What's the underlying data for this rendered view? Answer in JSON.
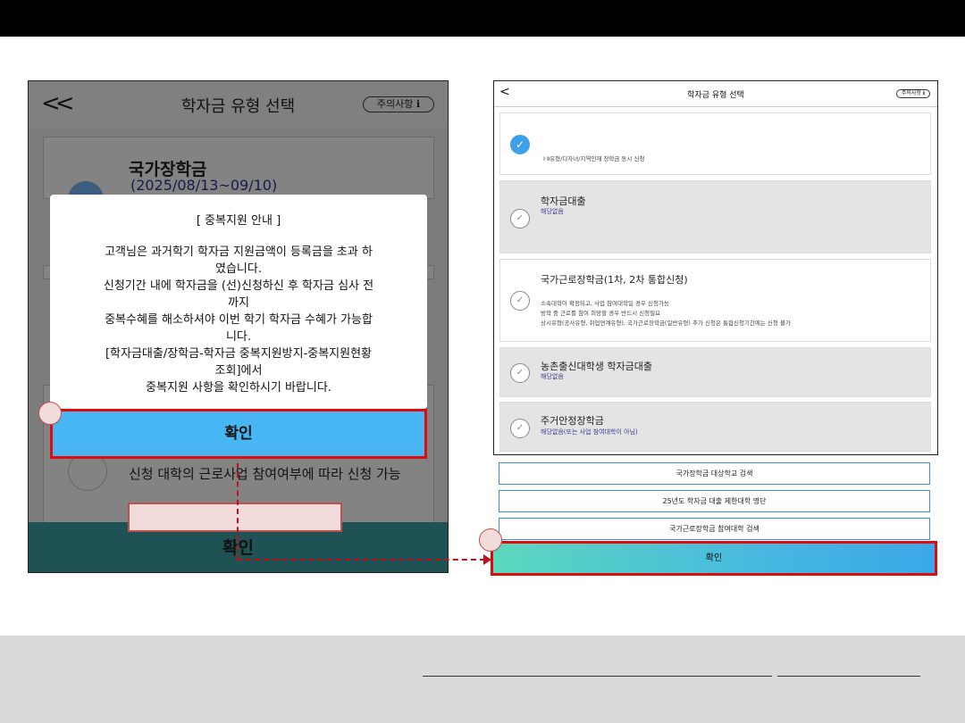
{
  "left": {
    "back_glyph": "<<",
    "title": "학자금 유형 선택",
    "notice_label": "주의사항 ℹ",
    "card_title": "국가장학금",
    "card_date": "(2025/08/13~09/10)",
    "bg_text": "신청 대학의 근로사업 참여여부에 따라 신청 가능",
    "footer_confirm": "확인",
    "dialog": {
      "title": "[ 중복지원 안내 ]",
      "lines": [
        "고객님은 과거학기 학자금 지원금액이 등록금을 초과 하",
        "였습니다.",
        "신청기간 내에 학자금을 (선)신청하신 후 학자금 심사 전",
        "까지",
        "중복수혜를 해소하셔야 이번 학기 학자금 수혜가 가능합",
        "니다.",
        "[학자금대출/장학금-학자금 중복지원방지-중복지원현황",
        "조회]에서",
        "중복지원 사항을 확인하시기 바랍니다."
      ],
      "confirm": "확인"
    }
  },
  "right": {
    "back_glyph": "<",
    "title": "학자금 유형 선택",
    "notice_label": "주의사항 ℹ",
    "cards": [
      {
        "title": "",
        "sub": "",
        "desc": [
          "Ⅰ·Ⅱ유형/다자녀/지역인재 장학금 동시 신청"
        ],
        "checked": true
      },
      {
        "title": "학자금대출",
        "sub": "해당없음",
        "desc": [],
        "checked": false
      },
      {
        "title": "국가근로장학금(1차, 2차 통합신청)",
        "sub": "",
        "desc": [
          "소속대학이 확정되고, 사업 참여대학일 경우 신청가능",
          "방학 중 근로를 참여 희망할 경우 반드시 신청필요",
          "상시유형(공사유형, 취업연계유형), 국가근로장학금(일반유형) 추가 신청은 통합신청기간에는 신청 불가"
        ],
        "checked": false
      },
      {
        "title": "농촌출신대학생 학자금대출",
        "sub": "해당없음",
        "desc": [],
        "checked": false
      },
      {
        "title": "주거안정장학금",
        "sub": "해당없음(또는 사업 참여대학이 아님)",
        "desc": [],
        "checked": false
      }
    ],
    "links": [
      "국가장학금 대상학교 검색",
      "25년도 학자금 대출 제한대학 명단",
      "국가근로장학금 참여대학 검색"
    ],
    "confirm": "확인"
  },
  "icons": {
    "check_on": "✓",
    "check_off": "✓"
  },
  "colors": {
    "accent_blue": "#47b6f3",
    "highlight_red": "#e20b0b",
    "check_blue": "#3fa0e8"
  }
}
